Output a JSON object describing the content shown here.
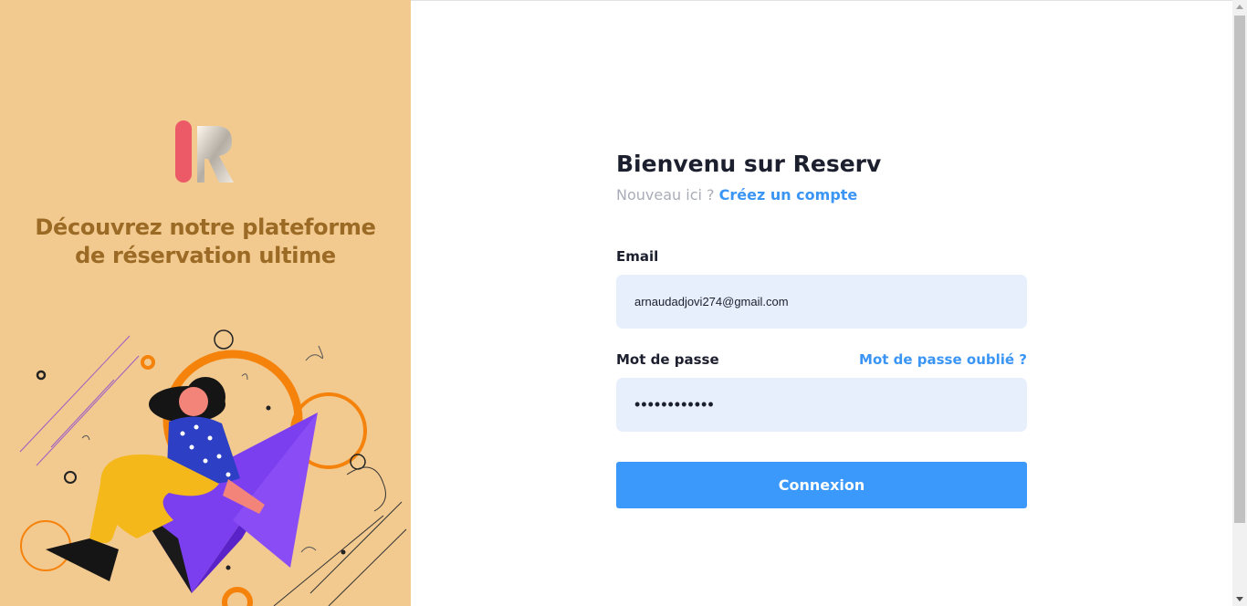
{
  "brand": {
    "logo_text": "IR",
    "tagline_line1": "Découvrez notre plateforme",
    "tagline_line2": "de réservation ultime"
  },
  "form": {
    "title": "Bienvenu sur Reserv",
    "new_here": "Nouveau ici ?",
    "create_account": "Créez un compte",
    "email_label": "Email",
    "email_value": "arnaudadjovi274@gmail.com",
    "password_label": "Mot de passe",
    "forgot_password": "Mot de passe oublié ?",
    "password_value": "••••••••••••",
    "submit_label": "Connexion"
  },
  "colors": {
    "panel_bg": "#f2c98f",
    "tagline": "#9b6a24",
    "accent": "#3a95f5",
    "button": "#3a99fb",
    "input_bg": "#e8effc"
  }
}
